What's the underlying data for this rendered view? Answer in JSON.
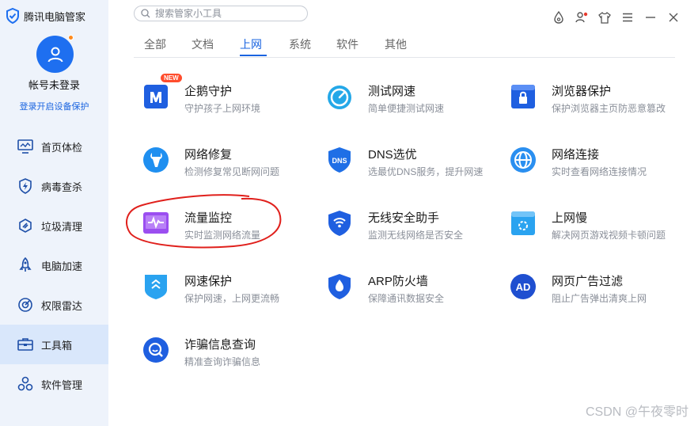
{
  "app": {
    "name": "腾讯电脑管家"
  },
  "account": {
    "name": "帐号未登录",
    "login_link": "登录开启设备保护"
  },
  "sidebar": {
    "items": [
      {
        "label": "首页体检",
        "icon": "monitor-icon"
      },
      {
        "label": "病毒查杀",
        "icon": "shield-bolt-icon"
      },
      {
        "label": "垃圾清理",
        "icon": "broom-icon"
      },
      {
        "label": "电脑加速",
        "icon": "rocket-icon"
      },
      {
        "label": "权限雷达",
        "icon": "radar-icon"
      },
      {
        "label": "工具箱",
        "icon": "toolbox-icon",
        "active": true
      },
      {
        "label": "软件管理",
        "icon": "apps-icon"
      }
    ]
  },
  "search": {
    "placeholder": "搜索管家小工具"
  },
  "tabs": [
    {
      "label": "全部"
    },
    {
      "label": "文档"
    },
    {
      "label": "上网",
      "active": true
    },
    {
      "label": "系统"
    },
    {
      "label": "软件"
    },
    {
      "label": "其他"
    }
  ],
  "tools": [
    {
      "name": "企鹅守护",
      "desc": "守护孩子上网环境",
      "icon": "penguin-shield-icon",
      "badge": "NEW"
    },
    {
      "name": "测试网速",
      "desc": "简单便捷测试网速",
      "icon": "speedometer-icon"
    },
    {
      "name": "浏览器保护",
      "desc": "保护浏览器主页防恶意篡改",
      "icon": "browser-lock-icon"
    },
    {
      "name": "网络修复",
      "desc": "检测修复常见断网问题",
      "icon": "wrench-icon"
    },
    {
      "name": "DNS选优",
      "desc": "选最优DNS服务，提升网速",
      "icon": "dns-shield-icon",
      "icon_text": "DNS"
    },
    {
      "name": "网络连接",
      "desc": "实时查看网络连接情况",
      "icon": "globe-icon"
    },
    {
      "name": "流量监控",
      "desc": "实时监测网络流量",
      "icon": "traffic-monitor-icon"
    },
    {
      "name": "无线安全助手",
      "desc": "监测无线网络是否安全",
      "icon": "wifi-shield-icon"
    },
    {
      "name": "上网慢",
      "desc": "解决网页游戏视频卡顿问题",
      "icon": "slow-browser-icon"
    },
    {
      "name": "网速保护",
      "desc": "保护网速，上网更流畅",
      "icon": "speed-shield-icon"
    },
    {
      "name": "ARP防火墙",
      "desc": "保障通讯数据安全",
      "icon": "firewall-icon"
    },
    {
      "name": "网页广告过滤",
      "desc": "阻止广告弹出清爽上网",
      "icon": "ad-filter-icon",
      "icon_text": "AD"
    },
    {
      "name": "诈骗信息查询",
      "desc": "精准查询诈骗信息",
      "icon": "fraud-search-icon"
    }
  ],
  "watermark": "CSDN @午夜零时",
  "colors": {
    "accent": "#1a64e0",
    "sidebar_bg": "#eef3fb",
    "annotation": "#e0201c"
  }
}
